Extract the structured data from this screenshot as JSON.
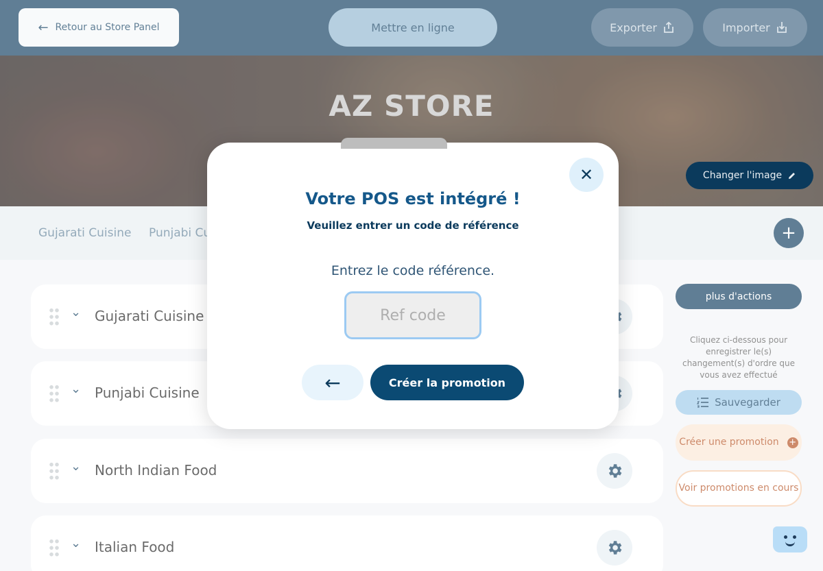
{
  "header": {
    "back_label": "Retour au Store Panel",
    "publish_label": "Mettre en ligne",
    "export_label": "Exporter",
    "import_label": "Importer"
  },
  "banner": {
    "store_name": "AZ STORE",
    "change_image_label": "Changer l'image"
  },
  "tabs": [
    "Gujarati Cuisine",
    "Punjabi Cu"
  ],
  "categories": [
    {
      "name": "Gujarati Cuisine"
    },
    {
      "name": "Punjabi Cuisine"
    },
    {
      "name": "North Indian Food"
    },
    {
      "name": "Italian Food"
    }
  ],
  "sidebar": {
    "more_actions_label": "plus d'actions",
    "help_text": "Cliquez ci-dessous pour enregistrer le(s) changement(s) d'ordre que vous avez effectué",
    "save_label": "Sauvegarder",
    "create_promo_label": "Créer une promotion",
    "see_promos_label": "Voir promotions en cours"
  },
  "modal": {
    "close_label": "✕",
    "title": "Votre POS est intégré !",
    "subtitle": "Veuillez entrer un code de référence",
    "prompt": "Entrez le code référence.",
    "input_placeholder": "Ref code",
    "input_value": "",
    "back_label": "←",
    "create_label": "Créer la promotion"
  },
  "colors": {
    "primary": "#0b3a5c",
    "accent_light": "#9cc9ea",
    "promo_orange": "#b34c1b",
    "modal_title": "#15588a"
  }
}
